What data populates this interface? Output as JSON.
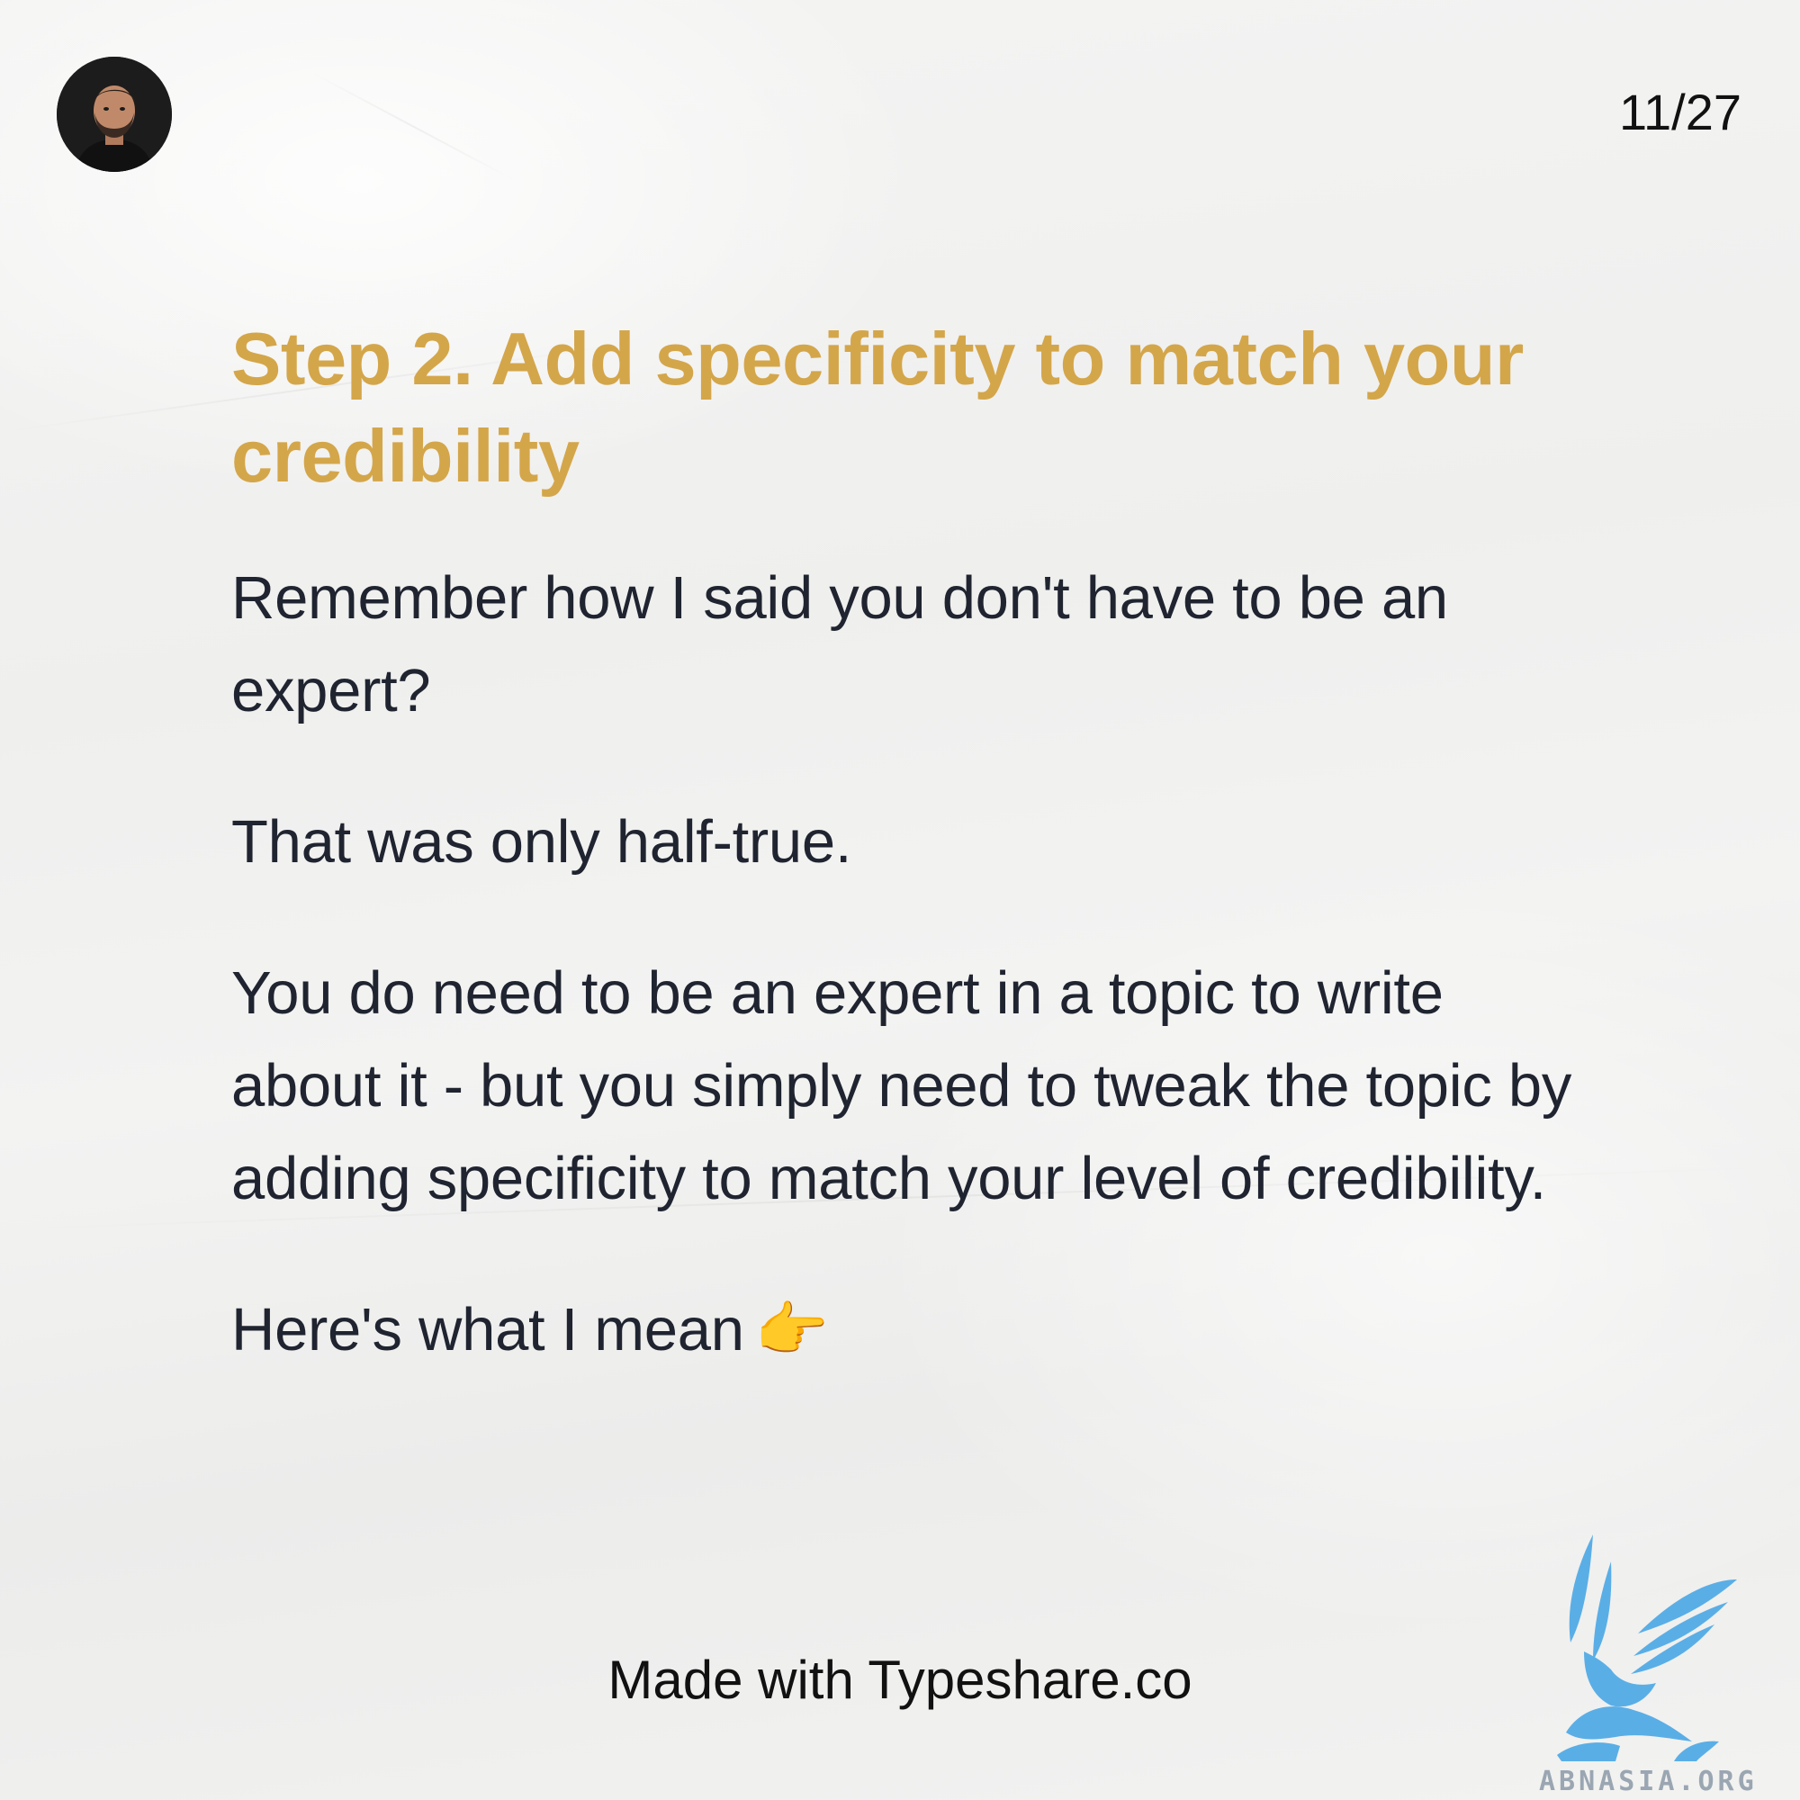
{
  "page_counter": "11/27",
  "heading": "Step 2. Add specificity to match your credibility",
  "paragraphs": {
    "p1": "Remember how I said you don't have to be an expert?",
    "p2": "That was only half-true.",
    "p3": "You do need to be an expert in a topic to write about it - but you simply need to tweak the topic by adding specificity to match your level of credibility.",
    "p4": "Here's what I mean"
  },
  "pointer_icon": "👉",
  "footer": "Made with Typeshare.co",
  "watermark": {
    "text": "ABNASIA.ORG",
    "icon": "griffin-icon"
  },
  "colors": {
    "heading": "#d4a64a",
    "body_text": "#1f2430",
    "background": "#f1f1f0",
    "watermark": "#5aaee6"
  }
}
